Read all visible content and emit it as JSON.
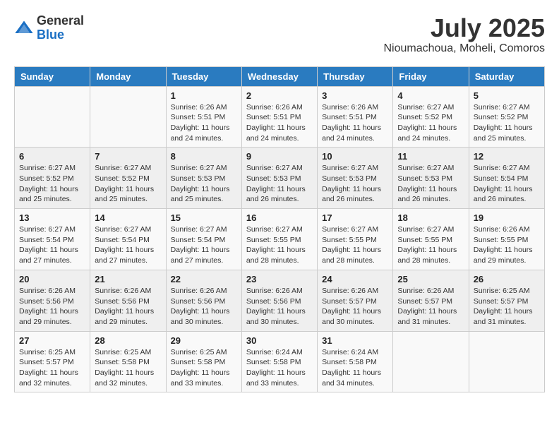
{
  "header": {
    "logo_general": "General",
    "logo_blue": "Blue",
    "month_title": "July 2025",
    "location": "Nioumachoua, Moheli, Comoros"
  },
  "days_of_week": [
    "Sunday",
    "Monday",
    "Tuesday",
    "Wednesday",
    "Thursday",
    "Friday",
    "Saturday"
  ],
  "weeks": [
    [
      {
        "day": "",
        "info": ""
      },
      {
        "day": "",
        "info": ""
      },
      {
        "day": "1",
        "info": "Sunrise: 6:26 AM\nSunset: 5:51 PM\nDaylight: 11 hours and 24 minutes."
      },
      {
        "day": "2",
        "info": "Sunrise: 6:26 AM\nSunset: 5:51 PM\nDaylight: 11 hours and 24 minutes."
      },
      {
        "day": "3",
        "info": "Sunrise: 6:26 AM\nSunset: 5:51 PM\nDaylight: 11 hours and 24 minutes."
      },
      {
        "day": "4",
        "info": "Sunrise: 6:27 AM\nSunset: 5:52 PM\nDaylight: 11 hours and 24 minutes."
      },
      {
        "day": "5",
        "info": "Sunrise: 6:27 AM\nSunset: 5:52 PM\nDaylight: 11 hours and 25 minutes."
      }
    ],
    [
      {
        "day": "6",
        "info": "Sunrise: 6:27 AM\nSunset: 5:52 PM\nDaylight: 11 hours and 25 minutes."
      },
      {
        "day": "7",
        "info": "Sunrise: 6:27 AM\nSunset: 5:52 PM\nDaylight: 11 hours and 25 minutes."
      },
      {
        "day": "8",
        "info": "Sunrise: 6:27 AM\nSunset: 5:53 PM\nDaylight: 11 hours and 25 minutes."
      },
      {
        "day": "9",
        "info": "Sunrise: 6:27 AM\nSunset: 5:53 PM\nDaylight: 11 hours and 26 minutes."
      },
      {
        "day": "10",
        "info": "Sunrise: 6:27 AM\nSunset: 5:53 PM\nDaylight: 11 hours and 26 minutes."
      },
      {
        "day": "11",
        "info": "Sunrise: 6:27 AM\nSunset: 5:53 PM\nDaylight: 11 hours and 26 minutes."
      },
      {
        "day": "12",
        "info": "Sunrise: 6:27 AM\nSunset: 5:54 PM\nDaylight: 11 hours and 26 minutes."
      }
    ],
    [
      {
        "day": "13",
        "info": "Sunrise: 6:27 AM\nSunset: 5:54 PM\nDaylight: 11 hours and 27 minutes."
      },
      {
        "day": "14",
        "info": "Sunrise: 6:27 AM\nSunset: 5:54 PM\nDaylight: 11 hours and 27 minutes."
      },
      {
        "day": "15",
        "info": "Sunrise: 6:27 AM\nSunset: 5:54 PM\nDaylight: 11 hours and 27 minutes."
      },
      {
        "day": "16",
        "info": "Sunrise: 6:27 AM\nSunset: 5:55 PM\nDaylight: 11 hours and 28 minutes."
      },
      {
        "day": "17",
        "info": "Sunrise: 6:27 AM\nSunset: 5:55 PM\nDaylight: 11 hours and 28 minutes."
      },
      {
        "day": "18",
        "info": "Sunrise: 6:27 AM\nSunset: 5:55 PM\nDaylight: 11 hours and 28 minutes."
      },
      {
        "day": "19",
        "info": "Sunrise: 6:26 AM\nSunset: 5:55 PM\nDaylight: 11 hours and 29 minutes."
      }
    ],
    [
      {
        "day": "20",
        "info": "Sunrise: 6:26 AM\nSunset: 5:56 PM\nDaylight: 11 hours and 29 minutes."
      },
      {
        "day": "21",
        "info": "Sunrise: 6:26 AM\nSunset: 5:56 PM\nDaylight: 11 hours and 29 minutes."
      },
      {
        "day": "22",
        "info": "Sunrise: 6:26 AM\nSunset: 5:56 PM\nDaylight: 11 hours and 30 minutes."
      },
      {
        "day": "23",
        "info": "Sunrise: 6:26 AM\nSunset: 5:56 PM\nDaylight: 11 hours and 30 minutes."
      },
      {
        "day": "24",
        "info": "Sunrise: 6:26 AM\nSunset: 5:57 PM\nDaylight: 11 hours and 30 minutes."
      },
      {
        "day": "25",
        "info": "Sunrise: 6:26 AM\nSunset: 5:57 PM\nDaylight: 11 hours and 31 minutes."
      },
      {
        "day": "26",
        "info": "Sunrise: 6:25 AM\nSunset: 5:57 PM\nDaylight: 11 hours and 31 minutes."
      }
    ],
    [
      {
        "day": "27",
        "info": "Sunrise: 6:25 AM\nSunset: 5:57 PM\nDaylight: 11 hours and 32 minutes."
      },
      {
        "day": "28",
        "info": "Sunrise: 6:25 AM\nSunset: 5:58 PM\nDaylight: 11 hours and 32 minutes."
      },
      {
        "day": "29",
        "info": "Sunrise: 6:25 AM\nSunset: 5:58 PM\nDaylight: 11 hours and 33 minutes."
      },
      {
        "day": "30",
        "info": "Sunrise: 6:24 AM\nSunset: 5:58 PM\nDaylight: 11 hours and 33 minutes."
      },
      {
        "day": "31",
        "info": "Sunrise: 6:24 AM\nSunset: 5:58 PM\nDaylight: 11 hours and 34 minutes."
      },
      {
        "day": "",
        "info": ""
      },
      {
        "day": "",
        "info": ""
      }
    ]
  ]
}
